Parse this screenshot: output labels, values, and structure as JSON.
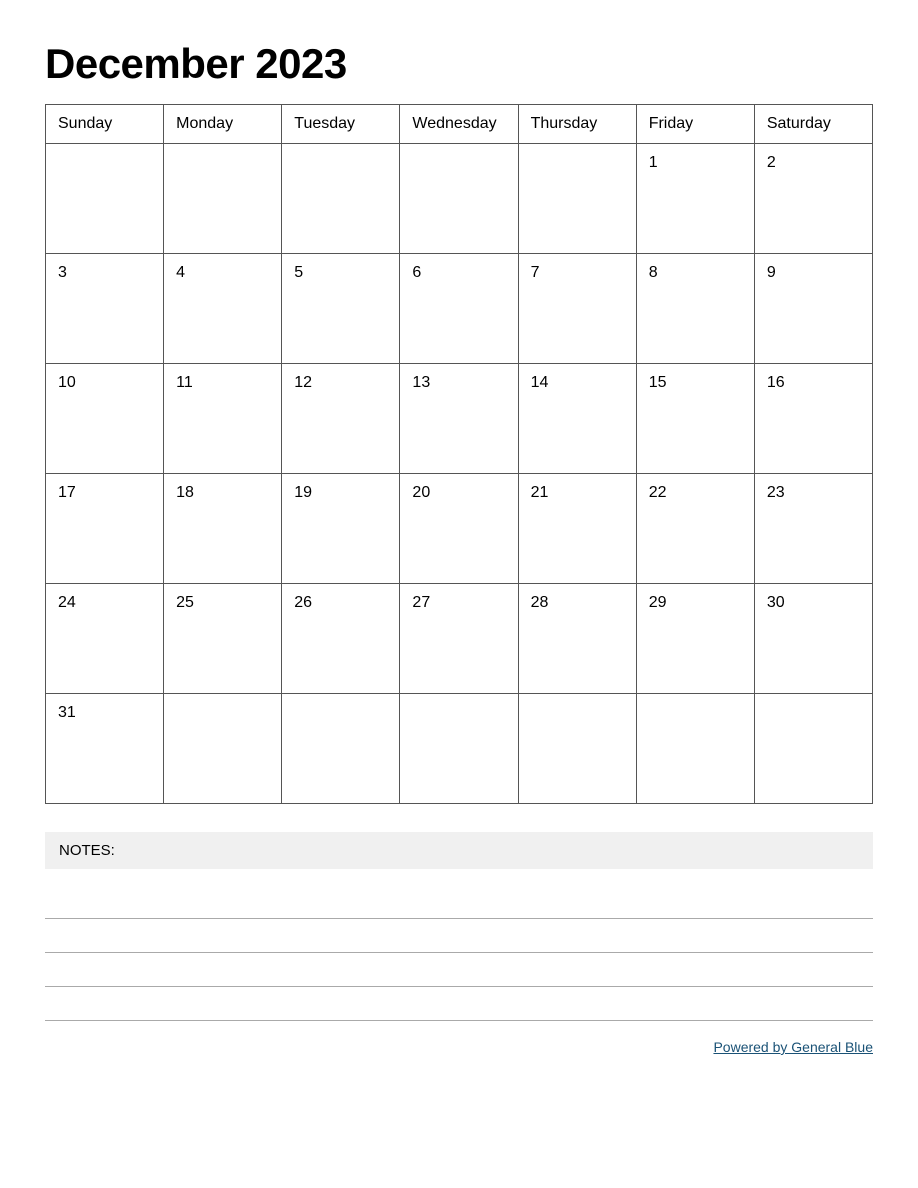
{
  "title": "December 2023",
  "days_of_week": [
    "Sunday",
    "Monday",
    "Tuesday",
    "Wednesday",
    "Thursday",
    "Friday",
    "Saturday"
  ],
  "weeks": [
    [
      {
        "day": "",
        "empty": true
      },
      {
        "day": "",
        "empty": true
      },
      {
        "day": "",
        "empty": true
      },
      {
        "day": "",
        "empty": true
      },
      {
        "day": "",
        "empty": true
      },
      {
        "day": "1",
        "empty": false
      },
      {
        "day": "2",
        "empty": false
      }
    ],
    [
      {
        "day": "3",
        "empty": false
      },
      {
        "day": "4",
        "empty": false
      },
      {
        "day": "5",
        "empty": false
      },
      {
        "day": "6",
        "empty": false
      },
      {
        "day": "7",
        "empty": false
      },
      {
        "day": "8",
        "empty": false
      },
      {
        "day": "9",
        "empty": false
      }
    ],
    [
      {
        "day": "10",
        "empty": false
      },
      {
        "day": "11",
        "empty": false
      },
      {
        "day": "12",
        "empty": false
      },
      {
        "day": "13",
        "empty": false
      },
      {
        "day": "14",
        "empty": false
      },
      {
        "day": "15",
        "empty": false
      },
      {
        "day": "16",
        "empty": false
      }
    ],
    [
      {
        "day": "17",
        "empty": false
      },
      {
        "day": "18",
        "empty": false
      },
      {
        "day": "19",
        "empty": false
      },
      {
        "day": "20",
        "empty": false
      },
      {
        "day": "21",
        "empty": false
      },
      {
        "day": "22",
        "empty": false
      },
      {
        "day": "23",
        "empty": false
      }
    ],
    [
      {
        "day": "24",
        "empty": false
      },
      {
        "day": "25",
        "empty": false
      },
      {
        "day": "26",
        "empty": false
      },
      {
        "day": "27",
        "empty": false
      },
      {
        "day": "28",
        "empty": false
      },
      {
        "day": "29",
        "empty": false
      },
      {
        "day": "30",
        "empty": false
      }
    ],
    [
      {
        "day": "31",
        "empty": false
      },
      {
        "day": "",
        "empty": true
      },
      {
        "day": "",
        "empty": true
      },
      {
        "day": "",
        "empty": true
      },
      {
        "day": "",
        "empty": true
      },
      {
        "day": "",
        "empty": true
      },
      {
        "day": "",
        "empty": true
      }
    ]
  ],
  "notes": {
    "label": "NOTES:",
    "lines_count": 4
  },
  "footer": {
    "text": "Powered by General Blue",
    "url": "#"
  }
}
